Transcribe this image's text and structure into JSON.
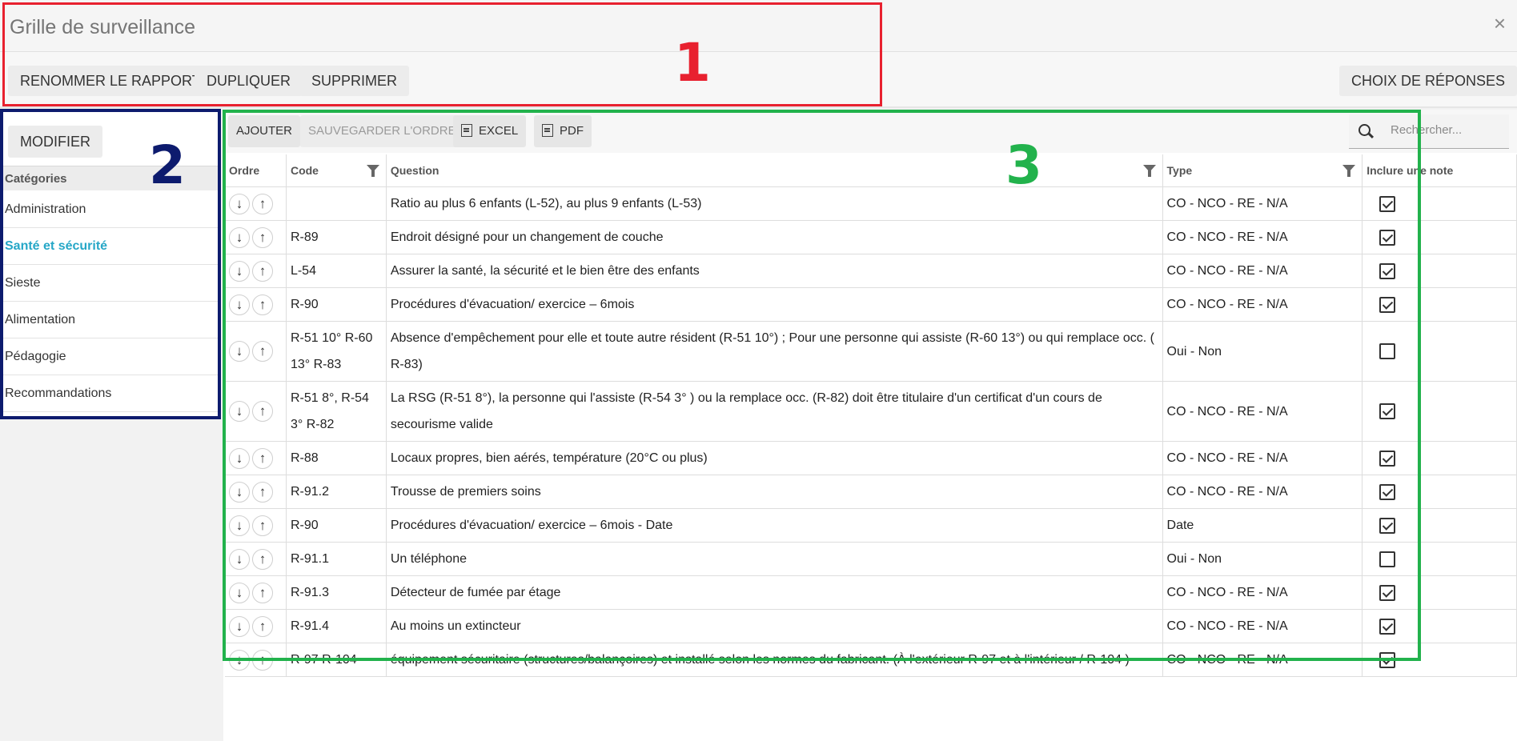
{
  "window": {
    "title": "Grille de surveillance",
    "close_glyph": "×"
  },
  "actions": {
    "rename": "RENOMMER LE RAPPORT",
    "duplicate": "DUPLIQUER",
    "delete": "SUPPRIMER",
    "answers": "CHOIX DE RÉPONSES"
  },
  "sidebar": {
    "modify": "MODIFIER",
    "header": "Catégories",
    "items": [
      {
        "label": "Administration"
      },
      {
        "label": "Santé et sécurité"
      },
      {
        "label": "Sieste"
      },
      {
        "label": "Alimentation"
      },
      {
        "label": "Pédagogie"
      },
      {
        "label": "Recommandations"
      }
    ],
    "active_index": 1
  },
  "grid": {
    "toolbar": {
      "add": "AJOUTER",
      "save_order": "SAUVEGARDER L'ORDRE",
      "excel": "EXCEL",
      "pdf": "PDF"
    },
    "search": {
      "placeholder": "Rechercher..."
    },
    "columns": {
      "order": "Ordre",
      "code": "Code",
      "question": "Question",
      "type": "Type",
      "note": "Inclure une note"
    },
    "rows": [
      {
        "code": "",
        "question": "Ratio au plus 6 enfants (L-52), au plus 9 enfants (L-53)",
        "type": "CO - NCO - RE - N/A",
        "note": true
      },
      {
        "code": "R-89",
        "question": "Endroit désigné pour un changement de couche",
        "type": "CO - NCO - RE - N/A",
        "note": true
      },
      {
        "code": "L-54",
        "question": "Assurer la santé, la sécurité et le bien être des enfants",
        "type": "CO - NCO - RE - N/A",
        "note": true
      },
      {
        "code": "R-90",
        "question": "Procédures d'évacuation/ exercice – 6mois",
        "type": "CO - NCO - RE - N/A",
        "note": true
      },
      {
        "code": "R-51 10° R-60 13° R-83",
        "question": "Absence d'empêchement pour elle et toute autre résident (R-51 10°) ; Pour une personne qui assiste (R-60 13°) ou qui remplace occ. ( R-83)",
        "type": "Oui - Non",
        "note": false
      },
      {
        "code": "R-51 8°, R-54 3° R-82",
        "question": "La RSG (R-51 8°), la personne qui l'assiste (R-54 3° ) ou la remplace occ. (R-82) doit être titulaire d'un certificat d'un cours de secourisme valide",
        "type": "CO - NCO - RE - N/A",
        "note": true
      },
      {
        "code": "R-88",
        "question": "Locaux propres, bien aérés, température (20°C ou plus)",
        "type": "CO - NCO - RE - N/A",
        "note": true
      },
      {
        "code": "R-91.2",
        "question": "Trousse de premiers soins",
        "type": "CO - NCO - RE - N/A",
        "note": true
      },
      {
        "code": "R-90",
        "question": "Procédures d'évacuation/ exercice – 6mois - Date",
        "type": "Date",
        "note": true
      },
      {
        "code": "R-91.1",
        "question": "Un téléphone",
        "type": "Oui - Non",
        "note": false
      },
      {
        "code": "R-91.3",
        "question": "Détecteur de fumée par étage",
        "type": "CO - NCO - RE - N/A",
        "note": true
      },
      {
        "code": "R-91.4",
        "question": "Au moins un extincteur",
        "type": "CO - NCO - RE - N/A",
        "note": true
      },
      {
        "code": "R-97 R-104",
        "question": "équipement sécuritaire (structures/balançoires) et installé selon les normes du fabricant. (À l'extérieur R-97 et à l'intérieur / R-104 )",
        "type": "CO - NCO - RE - N/A",
        "note": true
      }
    ]
  },
  "annotations": {
    "box1": "1",
    "box2": "2",
    "box3": "3"
  },
  "colors": {
    "red": "#e8212f",
    "blue": "#0d1b6e",
    "green": "#22b24c",
    "active": "#26a7c7"
  },
  "icons": [
    "close-icon",
    "search-icon",
    "excel-file-icon",
    "pdf-file-icon",
    "filter-icon",
    "arrow-down-icon",
    "arrow-up-icon",
    "checkbox-icon"
  ]
}
